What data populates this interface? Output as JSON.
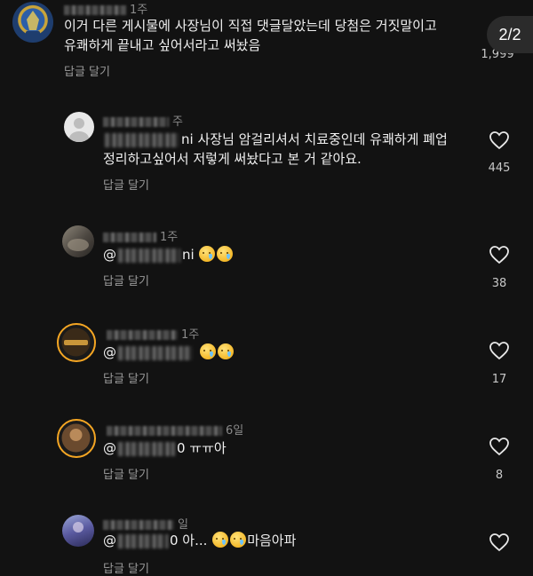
{
  "pager": "2/2",
  "comments": [
    {
      "time": "1주",
      "text_line1": "이거 다른 게시물에 사장님이 직접 댓글달았는데 당첨은 거짓말이고",
      "text_line2": "유쾌하게 끝내고 싶어서라고 써놨음",
      "reply": "답글 달기",
      "likes": "1,999",
      "avatar_icon": "police-badge-avatar-icon"
    },
    {
      "time": "주",
      "mention_suffix": "ni",
      "text_line1": "사장님 암걸리셔서 치료중인데 유쾌하게 폐업",
      "text_line2": "정리하고싶어서 저렇게 써놨다고 본 거 같아요.",
      "reply": "답글 달기",
      "likes": "445",
      "avatar_icon": "default-avatar-icon"
    },
    {
      "time": "1주",
      "mention_prefix": "@",
      "mention_suffix": "ni",
      "reply": "답글 달기",
      "likes": "38",
      "avatar_icon": "photo-avatar-icon"
    },
    {
      "time": "1주",
      "mention_prefix": "@",
      "reply": "답글 달기",
      "likes": "17",
      "avatar_icon": "story-ring-avatar-icon"
    },
    {
      "time": "6일",
      "mention_prefix": "@",
      "text_after": "0 ㅠㅠ아",
      "reply": "답글 달기",
      "likes": "8",
      "avatar_icon": "story-ring-avatar-icon"
    },
    {
      "time": "일",
      "mention_prefix": "@",
      "text_after": "0 아...",
      "text_end": "마음아파",
      "reply": "답글 달기",
      "likes": "",
      "avatar_icon": "photo-avatar-icon"
    }
  ],
  "colors": {
    "background": "#121212",
    "text": "#f0f0f0",
    "muted": "#8a8a8a",
    "pager_bg": "#2b2b2b",
    "story_ring": "#f5a623"
  }
}
